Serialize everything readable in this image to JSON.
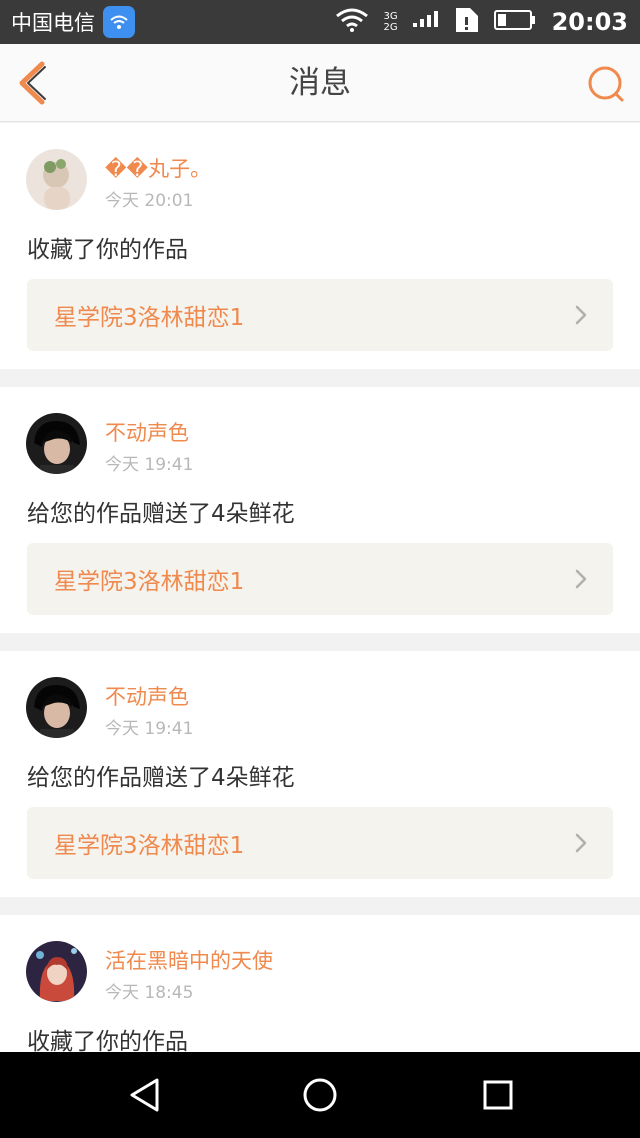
{
  "statusbar": {
    "carrier": "中国电信",
    "net_top": "3G",
    "net_bottom": "2G",
    "time": "20:03"
  },
  "header": {
    "title": "消息"
  },
  "messages": [
    {
      "user": "��丸子。",
      "time": "今天 20:01",
      "action": "收藏了你的作品",
      "work": "星学院3洛林甜恋1"
    },
    {
      "user": "不动声色",
      "time": "今天 19:41",
      "action": "给您的作品赠送了4朵鲜花",
      "work": "星学院3洛林甜恋1"
    },
    {
      "user": "不动声色",
      "time": "今天 19:41",
      "action": "给您的作品赠送了4朵鲜花",
      "work": "星学院3洛林甜恋1"
    },
    {
      "user": "活在黑暗中的天使",
      "time": "今天 18:45",
      "action": "收藏了你的作品"
    }
  ],
  "colors": {
    "accent": "#f0894d",
    "statusbar": "#3a3a3a",
    "card_link_bg": "#f4f3ed"
  }
}
